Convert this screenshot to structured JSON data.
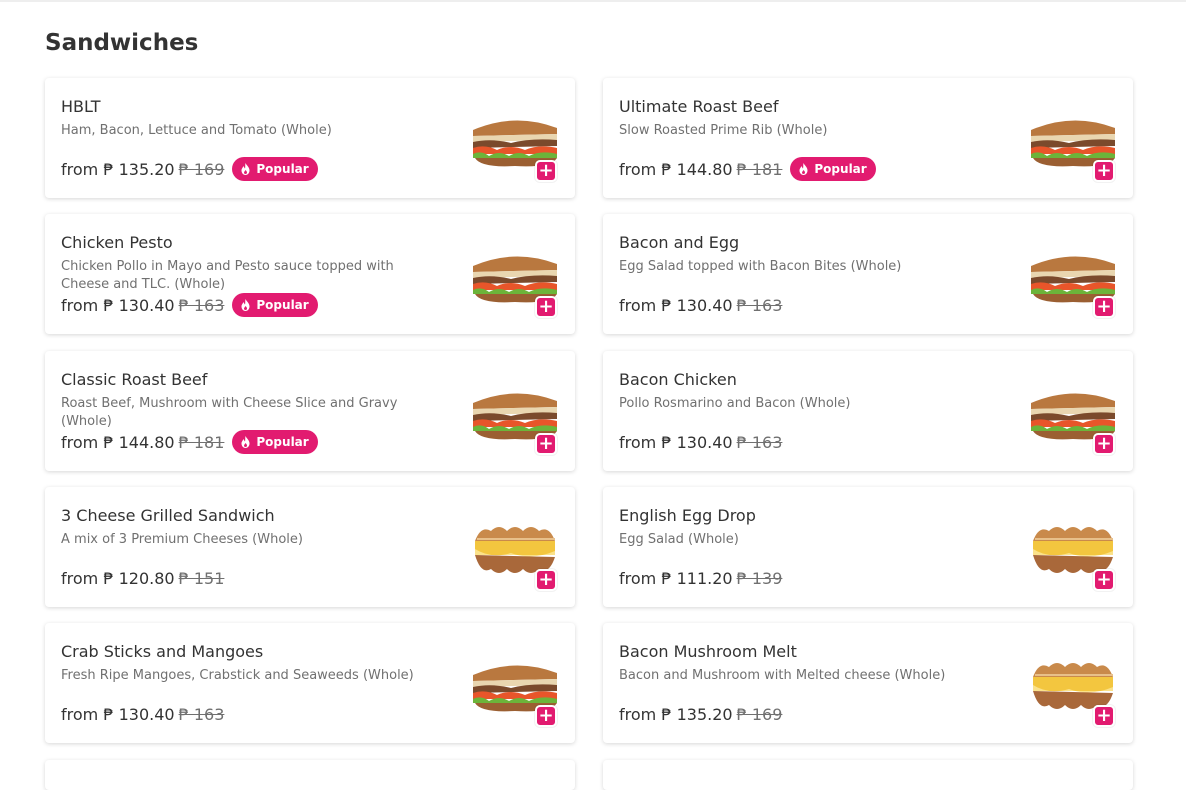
{
  "section": {
    "title": "Sandwiches"
  },
  "labels": {
    "popular": "Popular",
    "add": "+"
  },
  "colors": {
    "accent": "#e21b70",
    "text": "#333333",
    "muted": "#707070"
  },
  "items": [
    {
      "name": "HBLT",
      "description": "Ham, Bacon, Lettuce and Tomato (Whole)",
      "price": "from ₱ 135.20",
      "old_price": "₱ 169",
      "popular": true,
      "image": "sandwich-image"
    },
    {
      "name": "Ultimate Roast Beef",
      "description": "Slow Roasted Prime Rib (Whole)",
      "price": "from ₱ 144.80",
      "old_price": "₱ 181",
      "popular": true,
      "image": "sandwich-image"
    },
    {
      "name": "Chicken Pesto",
      "description": "Chicken Pollo in Mayo and Pesto sauce topped with Cheese and TLC. (Whole)",
      "price": "from ₱ 130.40",
      "old_price": "₱ 163",
      "popular": true,
      "image": "sandwich-image"
    },
    {
      "name": "Bacon and Egg",
      "description": "Egg Salad topped with Bacon Bites (Whole)",
      "price": "from ₱ 130.40",
      "old_price": "₱ 163",
      "popular": false,
      "image": "sandwich-image"
    },
    {
      "name": "Classic Roast Beef",
      "description": "Roast Beef, Mushroom with Cheese Slice and Gravy (Whole)",
      "price": "from ₱ 144.80",
      "old_price": "₱ 181",
      "popular": true,
      "image": "sandwich-image"
    },
    {
      "name": "Bacon Chicken",
      "description": "Pollo Rosmarino and Bacon (Whole)",
      "price": "from ₱ 130.40",
      "old_price": "₱ 163",
      "popular": false,
      "image": "sandwich-image"
    },
    {
      "name": "3 Cheese Grilled Sandwich",
      "description": "A mix of 3 Premium Cheeses (Whole)",
      "price": "from ₱ 120.80",
      "old_price": "₱ 151",
      "popular": false,
      "image": "grilled-sandwich-image"
    },
    {
      "name": "English Egg Drop",
      "description": "Egg Salad (Whole)",
      "price": "from ₱ 111.20",
      "old_price": "₱ 139",
      "popular": false,
      "image": "grilled-sandwich-image"
    },
    {
      "name": "Crab Sticks and Mangoes",
      "description": "Fresh Ripe Mangoes, Crabstick and Seaweeds (Whole)",
      "price": "from ₱ 130.40",
      "old_price": "₱ 163",
      "popular": false,
      "image": "sandwich-image"
    },
    {
      "name": "Bacon Mushroom Melt",
      "description": "Bacon and Mushroom with Melted cheese (Whole)",
      "price": "from ₱ 135.20",
      "old_price": "₱ 169",
      "popular": false,
      "image": "grilled-sandwich-image"
    }
  ]
}
